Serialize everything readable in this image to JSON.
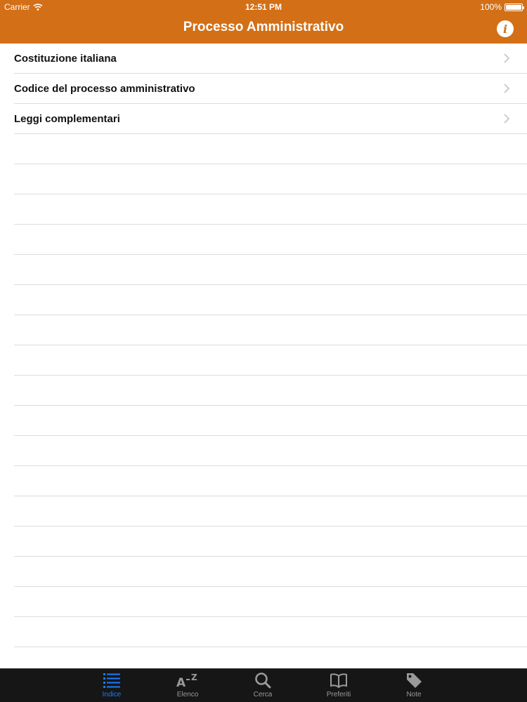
{
  "status_bar": {
    "carrier": "Carrier",
    "time": "12:51 PM",
    "battery": "100%"
  },
  "nav": {
    "title": "Processo Amministrativo",
    "info_icon": "info-icon"
  },
  "list": {
    "items": [
      {
        "label": "Costituzione italiana"
      },
      {
        "label": "Codice del processo amministrativo"
      },
      {
        "label": "Leggi complementari"
      }
    ]
  },
  "tabbar": {
    "tabs": [
      {
        "label": "Indice",
        "icon": "list-icon",
        "active": true
      },
      {
        "label": "Elenco",
        "icon": "a-z-icon"
      },
      {
        "label": "Cerca",
        "icon": "search-icon"
      },
      {
        "label": "Preferiti",
        "icon": "book-icon"
      },
      {
        "label": "Note",
        "icon": "tag-icon"
      }
    ]
  },
  "colors": {
    "accent": "#d36f16",
    "tab_active": "#1a7cff",
    "tabbar_bg": "#161616"
  }
}
